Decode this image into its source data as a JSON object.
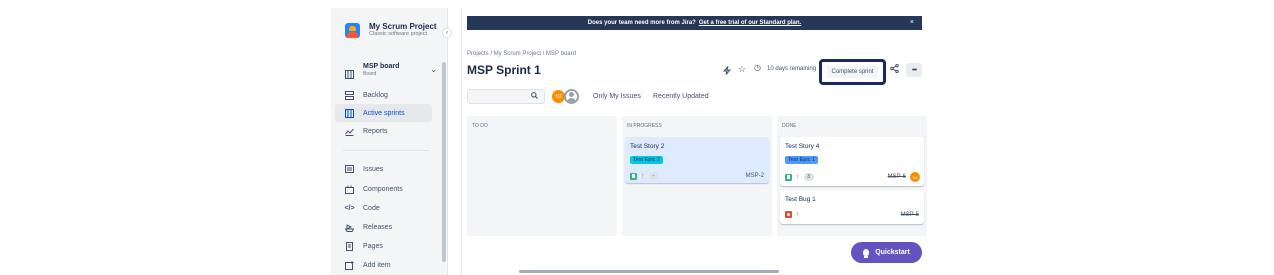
{
  "sidebar": {
    "project_name": "My Scrum Project",
    "project_type": "Classic software project",
    "board_name": "MSP board",
    "board_sub": "Board",
    "items": [
      {
        "label": "Backlog"
      },
      {
        "label": "Active sprints"
      },
      {
        "label": "Reports"
      },
      {
        "label": "Issues"
      },
      {
        "label": "Components"
      },
      {
        "label": "Code"
      },
      {
        "label": "Releases"
      },
      {
        "label": "Pages"
      },
      {
        "label": "Add item"
      }
    ]
  },
  "banner": {
    "text": "Does your team need more from Jira?",
    "link": "Get a free trial of our Standard plan.",
    "close": "×"
  },
  "header": {
    "breadcrumb": "Projects / My Scrum Project / MSP board",
    "title": "MSP Sprint 1",
    "days_remaining": "10 days remaining",
    "complete_label": "Complete sprint",
    "more_label": "•••"
  },
  "filters": {
    "avatar_initials": "VJ",
    "only_my_issues": "Only My Issues",
    "recently_updated": "Recently Updated"
  },
  "columns": [
    {
      "name": "TO DO"
    },
    {
      "name": "IN PROGRESS"
    },
    {
      "name": "DONE"
    }
  ],
  "cards": {
    "story2": {
      "title": "Test Story 2",
      "epic": "Test Epic 2",
      "points": "-",
      "key": "MSP-2"
    },
    "story4": {
      "title": "Test Story 4",
      "epic": "Test Epic 1",
      "points": "3",
      "key": "MSP-6",
      "assignee": "VJ"
    },
    "bug1": {
      "title": "Test Bug 1",
      "key": "MSP-5"
    }
  },
  "quickstart_label": "Quickstart",
  "colors": {
    "banner_bg": "#253858",
    "epic_cyan": "#00c7e6",
    "epic_blue": "#4c9aff",
    "quickstart": "#6554c0",
    "highlight_border": "#172b60"
  }
}
